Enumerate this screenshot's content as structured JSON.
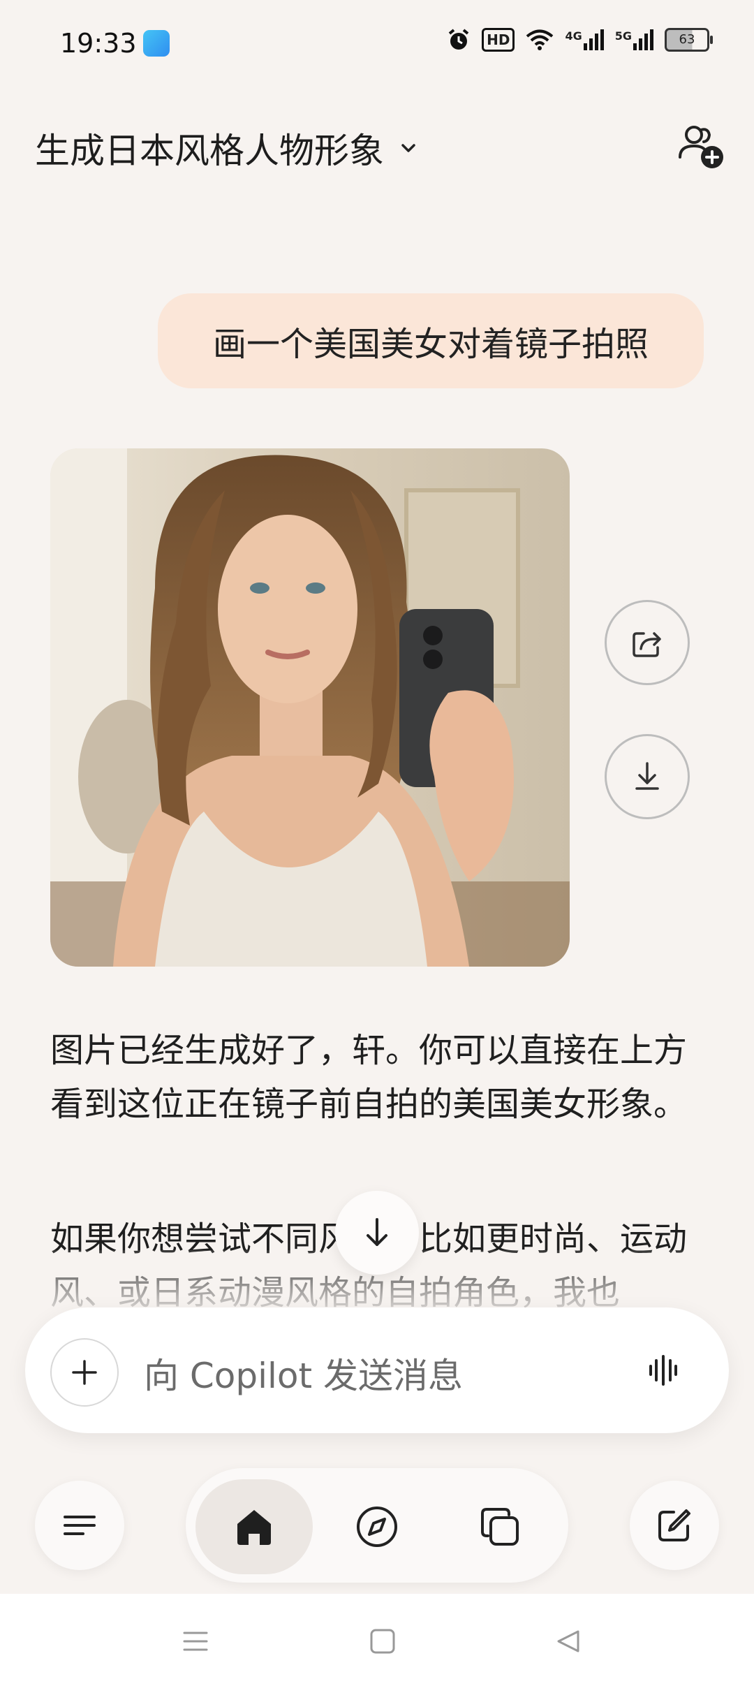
{
  "status_bar": {
    "time": "19:33",
    "hd_label": "HD",
    "network_1": "4G",
    "network_2": "5G",
    "battery": "63"
  },
  "header": {
    "title": "生成日本风格人物形象"
  },
  "chat": {
    "user_message": "画一个美国美女对着镜子拍照",
    "assistant_paragraph_1": "图片已经生成好了，轩。你可以直接在上方看到这位正在镜子前自拍的美国美女形象。",
    "assistant_paragraph_2": "如果你想尝试不同风格，比如更时尚、运动风、或日系动漫风格的自拍角色，我也"
  },
  "composer": {
    "placeholder": "向 Copilot 发送消息"
  },
  "icons": {
    "header_right": "add-people-icon",
    "share": "share-icon",
    "download": "download-icon",
    "scroll": "arrow-down-icon",
    "plus": "plus-icon",
    "voice": "voice-waveform-icon",
    "menu": "menu-icon",
    "home": "home-icon",
    "discover": "compass-icon",
    "pages": "pages-icon",
    "new_chat": "edit-icon"
  },
  "colors": {
    "background": "#f7f3f0",
    "user_bubble": "#fbe6d8",
    "text": "#1f1f1f"
  }
}
